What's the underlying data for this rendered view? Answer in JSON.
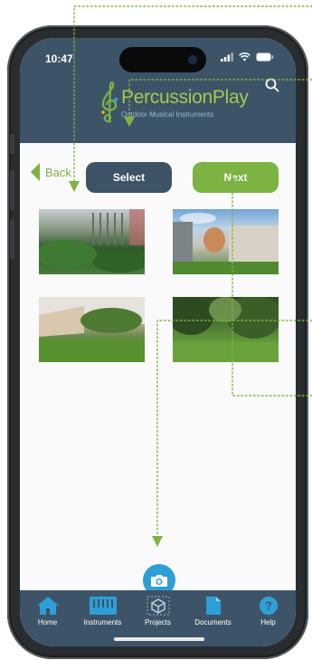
{
  "status_bar": {
    "time": "10:47"
  },
  "brand": {
    "name": "PercussionPlay",
    "tagline": "Outdoor Musical Instruments",
    "colors": {
      "header": "#3d5468",
      "accent_green": "#7cb342",
      "camera_blue": "#2e9fd6"
    }
  },
  "toolbar": {
    "back_label": "Back",
    "select_label": "Select",
    "next_label": "Next"
  },
  "photos": [
    {
      "name": "garden-photo-1"
    },
    {
      "name": "garden-photo-2"
    },
    {
      "name": "garden-photo-3"
    },
    {
      "name": "garden-photo-4"
    }
  ],
  "camera": {
    "icon": "camera-icon"
  },
  "tabbar": {
    "items": [
      {
        "label": "Home",
        "icon": "home-icon"
      },
      {
        "label": "Instruments",
        "icon": "piano-icon"
      },
      {
        "label": "Projects",
        "icon": "cube-icon"
      },
      {
        "label": "Documents",
        "icon": "document-icon"
      },
      {
        "label": "Help",
        "icon": "help-icon"
      }
    ]
  }
}
